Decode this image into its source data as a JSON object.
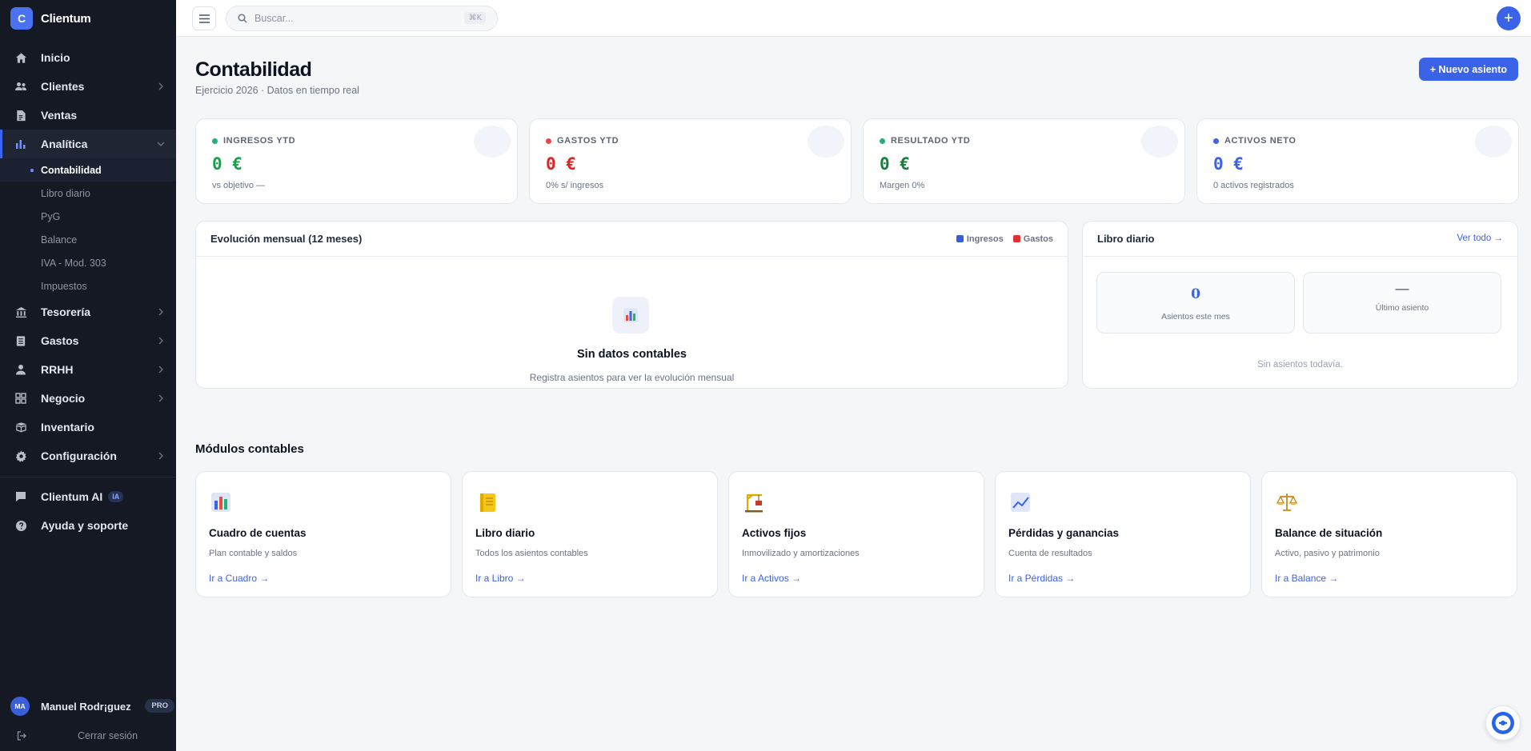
{
  "brand": {
    "logo_letter": "C",
    "name": "Clientum"
  },
  "sidebar": {
    "items": [
      {
        "label": "Inicio",
        "icon": "home-icon"
      },
      {
        "label": "Clientes",
        "icon": "users-icon"
      },
      {
        "label": "Ventas",
        "icon": "document-icon"
      },
      {
        "label": "Analítica",
        "icon": "bar-chart-icon",
        "active": true
      },
      {
        "label": "Tesorería",
        "icon": "bank-icon"
      },
      {
        "label": "Gastos",
        "icon": "receipt-icon"
      },
      {
        "label": "RRHH",
        "icon": "person-icon"
      },
      {
        "label": "Negocio",
        "icon": "grid-icon"
      },
      {
        "label": "Inventario",
        "icon": "box-icon"
      },
      {
        "label": "Configuración",
        "icon": "gear-icon"
      }
    ],
    "subitems": [
      "Contabilidad",
      "Libro diario",
      "PyG",
      "Balance",
      "IVA - Mod. 303",
      "Impuestos"
    ],
    "ai": {
      "label": "Clientum AI",
      "badge": "IA"
    },
    "help": "Ayuda y soporte",
    "user": {
      "initials": "MA",
      "name": "Manuel Rodr¡guez",
      "plan": "PRO"
    },
    "logout": "Cerrar sesión"
  },
  "topbar": {
    "search_placeholder": "Buscar...",
    "shortcut": "⌘K",
    "add": "+"
  },
  "page": {
    "title": "Contabilidad",
    "subtitle": "Ejercicio 2026 · Datos en tiempo real",
    "new_button": "+ Nuevo asiento"
  },
  "kpis": [
    {
      "label": "INGRESOS YTD",
      "value": "0 €",
      "note": "vs objetivo —",
      "color": "#16a34a",
      "dot": "#22b07d"
    },
    {
      "label": "GASTOS YTD",
      "value": "0 €",
      "note": "0% s/ ingresos",
      "color": "#dc2626",
      "dot": "#ef4444"
    },
    {
      "label": "RESULTADO YTD",
      "value": "0 €",
      "note": "Margen 0%",
      "color": "#15803d",
      "dot": "#22b07d"
    },
    {
      "label": "ACTIVOS NETO",
      "value": "0 €",
      "note": "0 activos registrados",
      "color": "#3b63e8",
      "dot": "#3b63e8"
    }
  ],
  "evolucion": {
    "title": "Evolución mensual (12 meses)",
    "legend": [
      {
        "label": "Ingresos",
        "color": "#3b5bdb"
      },
      {
        "label": "Gastos",
        "color": "#e03131"
      }
    ],
    "empty_title": "Sin datos contables",
    "empty_sub": "Registra asientos para ver la evolución mensual"
  },
  "libro": {
    "title": "Libro diario",
    "link": "Ver todo →",
    "stats": [
      {
        "value": "0",
        "label": "Asientos este mes"
      },
      {
        "value": "—",
        "label": "Último asiento"
      }
    ],
    "empty": "Sin asientos todavía."
  },
  "modules": {
    "title": "Módulos contables",
    "items": [
      {
        "title": "Cuadro de cuentas",
        "desc": "Plan contable y saldos",
        "link": "Ir a Cuadro →",
        "icon": "bar-chart-icon"
      },
      {
        "title": "Libro diario",
        "desc": "Todos los asientos contables",
        "link": "Ir a Libro →",
        "icon": "notebook-icon"
      },
      {
        "title": "Activos fijos",
        "desc": "Inmovilizado y amortizaciones",
        "link": "Ir a Activos →",
        "icon": "crane-icon"
      },
      {
        "title": "Pérdidas y ganancias",
        "desc": "Cuenta de resultados",
        "link": "Ir a Pérdidas →",
        "icon": "trend-chart-icon"
      },
      {
        "title": "Balance de situación",
        "desc": "Activo, pasivo y patrimonio",
        "link": "Ir a Balance →",
        "icon": "scales-icon"
      }
    ]
  },
  "help_fab": {
    "icon": "chat-assistant-icon"
  }
}
